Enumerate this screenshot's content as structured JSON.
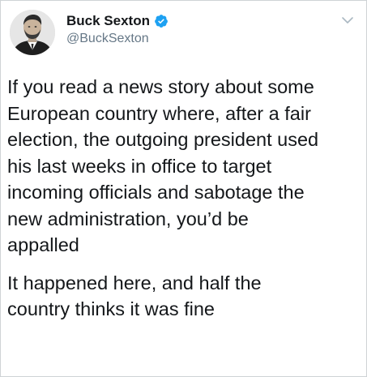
{
  "tweet": {
    "author": {
      "display_name": "Buck Sexton",
      "handle": "@BuckSexton",
      "verified": true,
      "verified_color": "#1da1f2"
    },
    "paragraphs": [
      "If you read a news story about some\nEuropean country where, after a fair\nelection, the outgoing president used\nhis last weeks in office to target\nincoming officials and sabotage the\nnew administration, you’d be\nappalled",
      "It happened here, and half the\ncountry thinks it was fine"
    ],
    "menu_icon": "chevron-down-icon"
  }
}
